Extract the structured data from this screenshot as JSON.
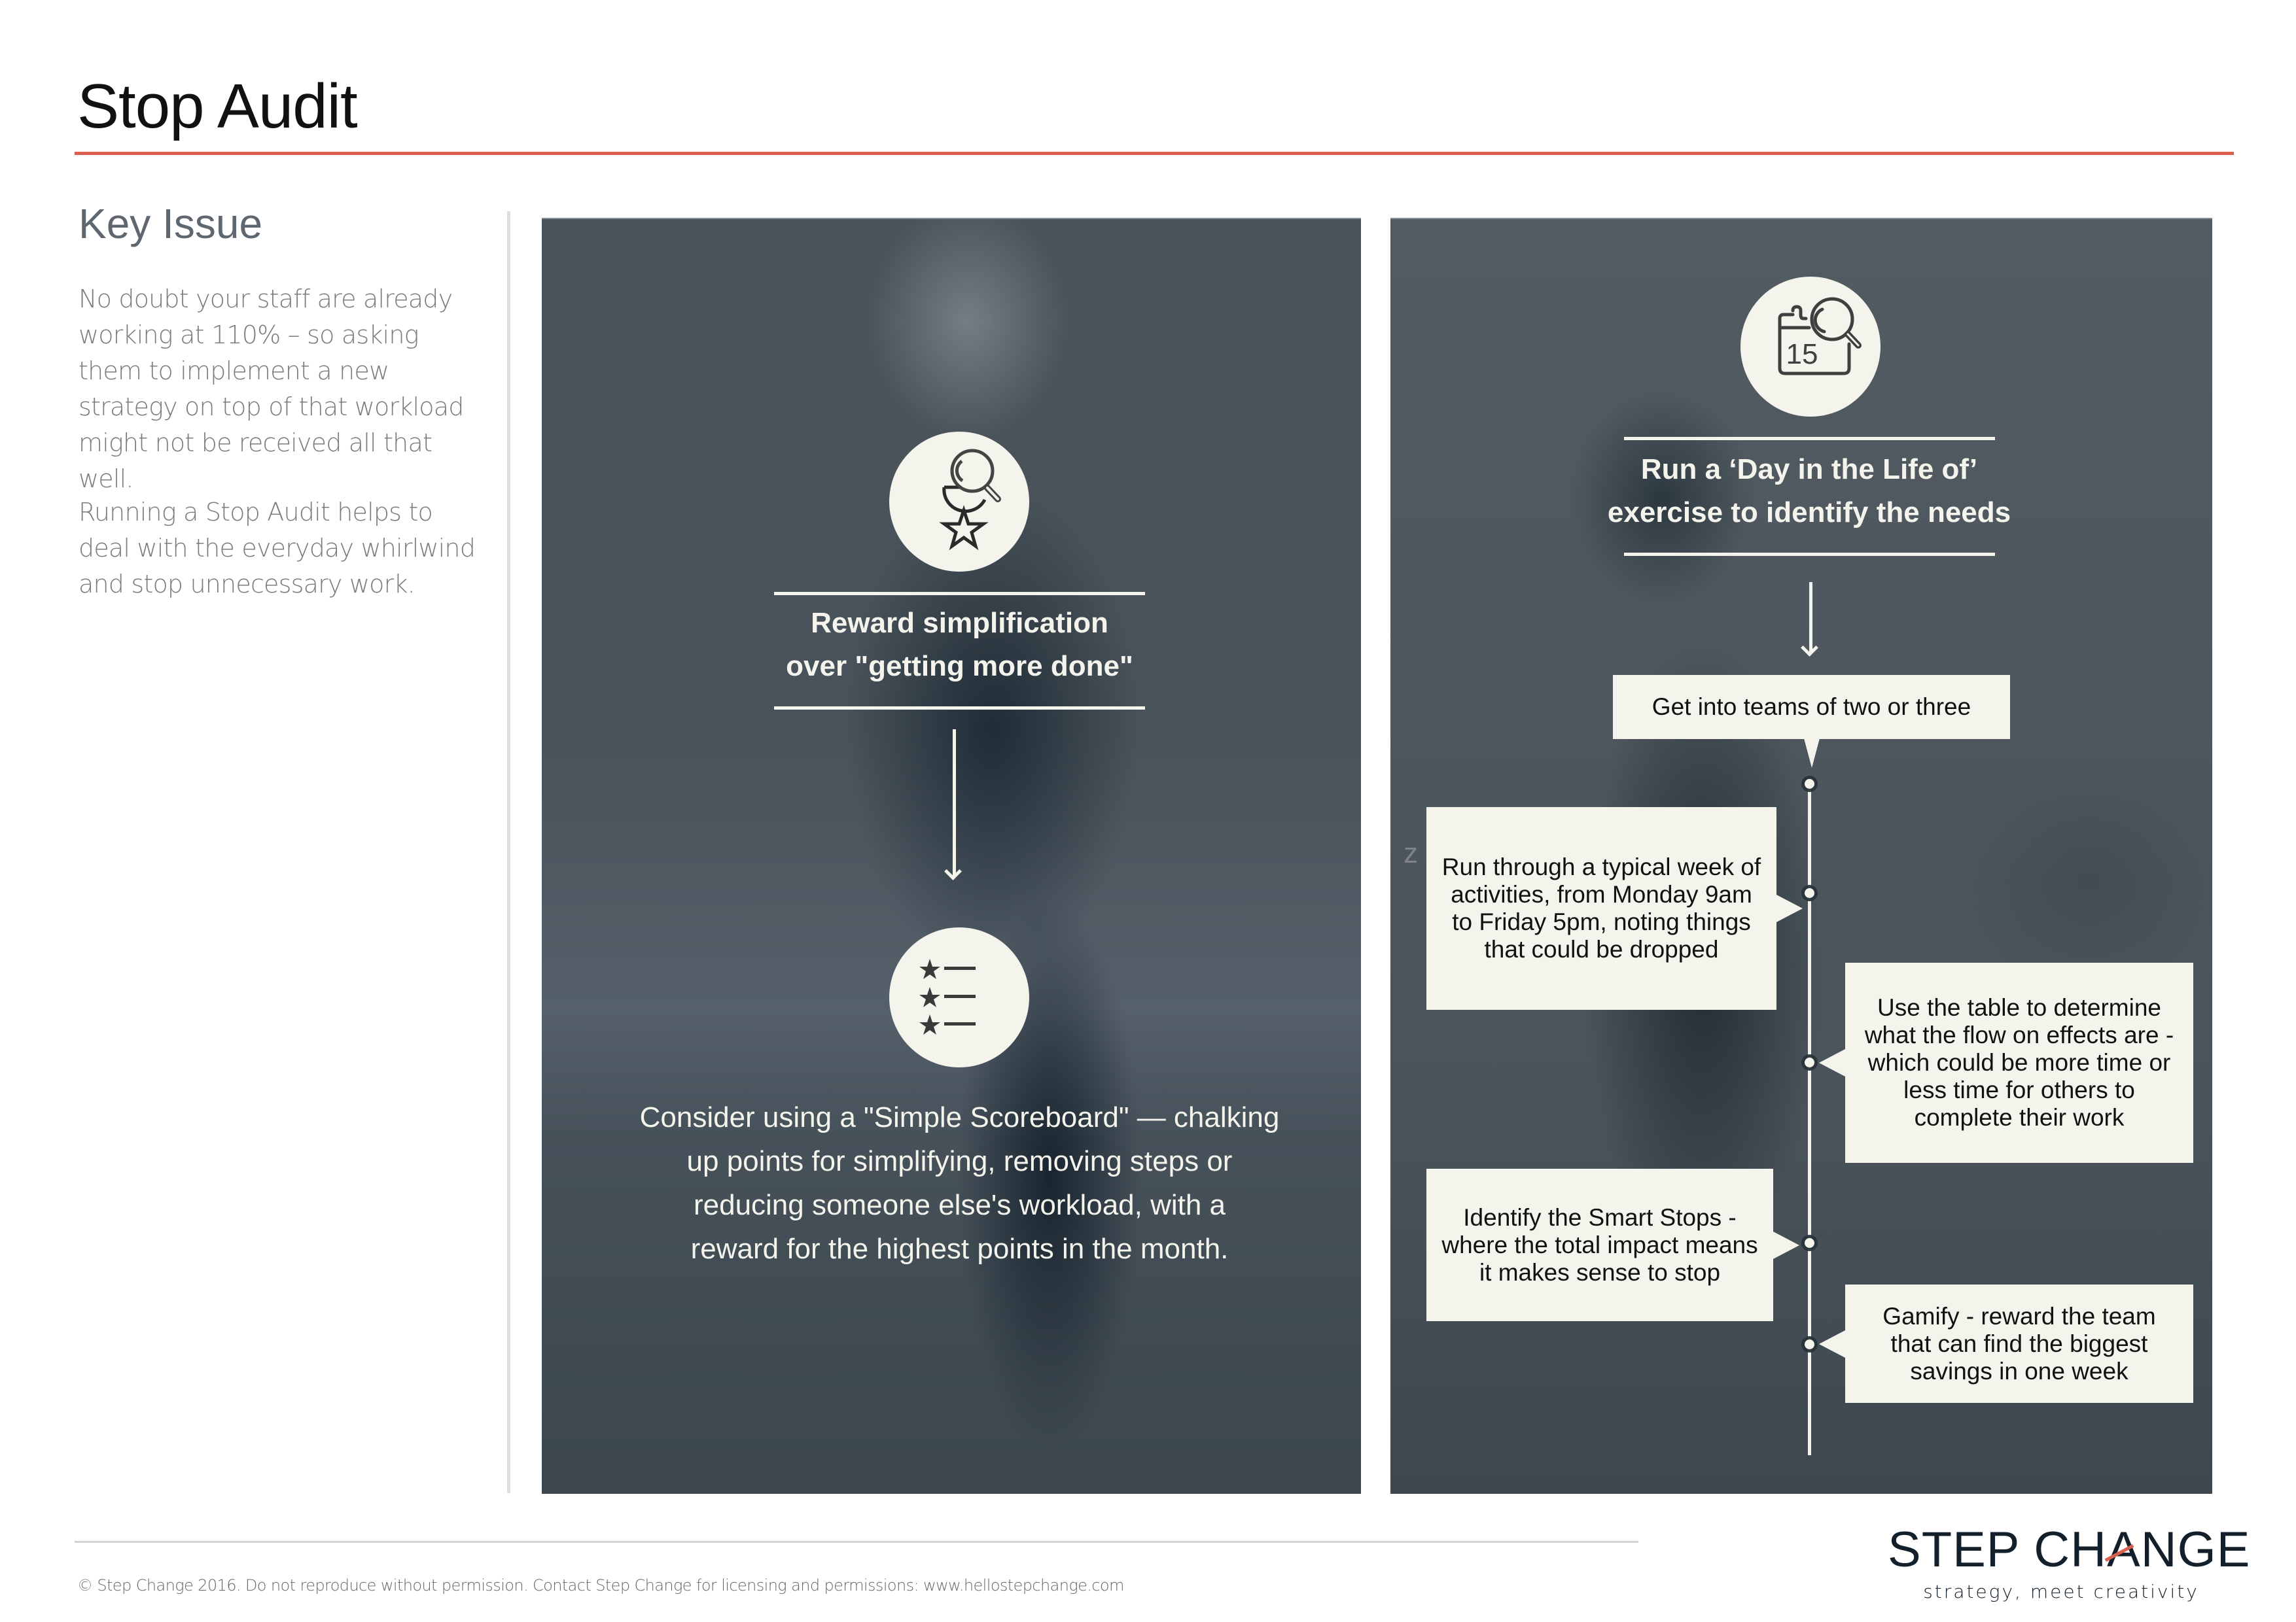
{
  "header": {
    "title": "Stop Audit"
  },
  "sidebar": {
    "heading": "Key Issue",
    "paragraphs": [
      "No doubt your staff are already working at 110% – so asking them to implement a new strategy on top of that workload might not be received all that well.",
      "Running a Stop Audit helps to deal with the everyday whirlwind and stop unnecessary work."
    ]
  },
  "left_panel": {
    "icon_top": "reward-search-star-icon",
    "heading_lines": [
      "Reward simplification",
      "over \"getting more done\""
    ],
    "icon_bottom": "star-list-scoreboard-icon",
    "body_lines": [
      "Consider using a \"Simple Scoreboard\" — chalking",
      "up points for simplifying, removing steps or",
      "reducing someone else's workload, with a",
      "reward for the highest points in the month."
    ]
  },
  "right_panel": {
    "icon_top": "calendar-search-icon",
    "calendar_day": "15",
    "heading_lines": [
      "Run a ‘Day in the Life of’",
      "exercise to identify the needs"
    ],
    "start_step": "Get into teams of two or three",
    "stray_glyph": "z",
    "steps": [
      {
        "side": "left",
        "text": "Run through a typical week of activities, from Monday 9am to Friday 5pm, noting things that could be dropped"
      },
      {
        "side": "right",
        "text": "Use the table to determine what the flow on effects are - which could be more time or less time for others to complete their work"
      },
      {
        "side": "left",
        "text": "Identify the Smart Stops - where the total impact means it makes sense to stop"
      },
      {
        "side": "right",
        "text": "Gamify - reward the team that can find the biggest savings in one week"
      }
    ]
  },
  "footer": {
    "copyright": "© Step Change 2016. Do not reproduce without permission. Contact Step Change for licensing and permissions: www.hellostepchange.com",
    "logo_wordmark": "STEP CHANGE",
    "logo_tagline": "strategy, meet creativity"
  },
  "colors": {
    "accent": "#d9604f",
    "panel_text": "#f4f4ed",
    "logo": "#13202b"
  }
}
